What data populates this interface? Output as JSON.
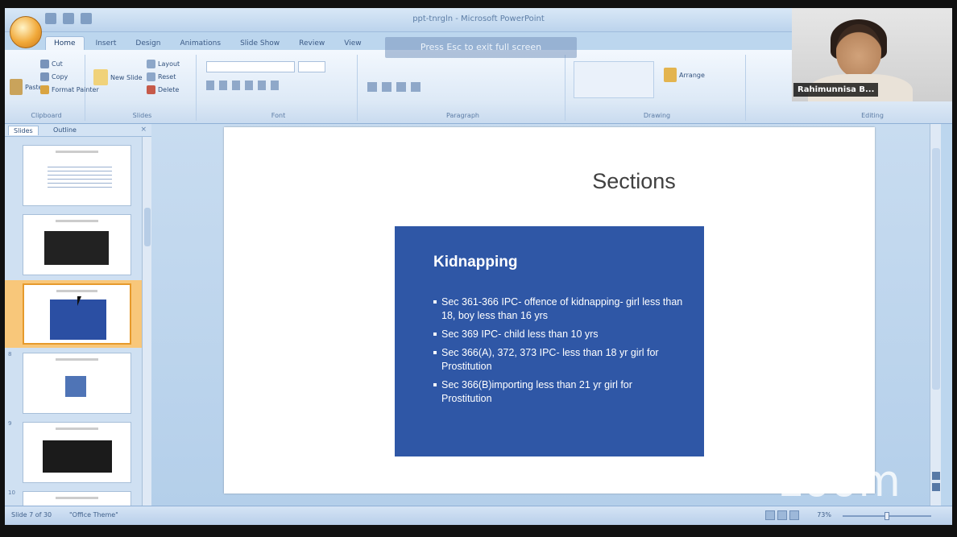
{
  "window": {
    "title": "ppt-tnrgln - Microsoft PowerPoint"
  },
  "ribbon": {
    "tabs": [
      "Home",
      "Insert",
      "Design",
      "Animations",
      "Slide Show",
      "Review",
      "View"
    ],
    "active_tab": "Home",
    "clipboard": {
      "paste": "Paste",
      "cut": "Cut",
      "copy": "Copy",
      "format_painter": "Format Painter",
      "label": "Clipboard"
    },
    "slides": {
      "new_slide": "New Slide",
      "layout": "Layout",
      "reset": "Reset",
      "delete": "Delete",
      "label": "Slides"
    },
    "font_label": "Font",
    "paragraph_label": "Paragraph",
    "drawing": {
      "arrange": "Arrange",
      "label": "Drawing"
    },
    "editing_label": "Editing",
    "escape_banner": "Press Esc to exit full screen"
  },
  "webcam": {
    "name": "Rahimunnisa B..."
  },
  "panel": {
    "tabs": [
      "Slides",
      "Outline"
    ],
    "close_glyph": "×",
    "thumb_numbers": [
      "",
      "",
      "",
      "8",
      "9",
      "10"
    ]
  },
  "slide": {
    "title": "Sections",
    "box_heading": "Kidnapping",
    "bullets": [
      "Sec 361-366 IPC- offence of kidnapping- girl less than 18, boy less than 16 yrs",
      "Sec 369 IPC- child less than 10 yrs",
      "Sec 366(A), 372, 373 IPC- less than 18 yr girl for Prostitution",
      "Sec 366(B)importing less than 21 yr girl for Prostitution"
    ]
  },
  "overlay": {
    "zoom_logo": "zoom"
  },
  "statusbar": {
    "slide_info": "Slide 7 of 30",
    "theme": "\"Office Theme\"",
    "zoom": "73%"
  }
}
